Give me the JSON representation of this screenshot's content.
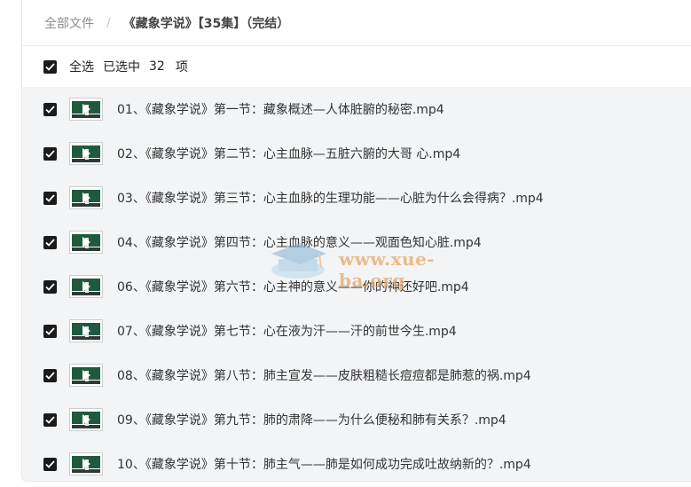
{
  "breadcrumb": {
    "root": "全部文件",
    "separator": "/",
    "current": "《藏象学说》【35集】（完结）"
  },
  "selection": {
    "select_all_label": "全选",
    "selected_label": "已选中",
    "count": "32",
    "unit": "项",
    "all_checked": true
  },
  "files": [
    {
      "name": "01、《藏象学说》第一节：藏象概述—人体脏腑的秘密.mp4",
      "checked": true
    },
    {
      "name": "02、《藏象学说》第二节：心主血脉—五脏六腑的大哥 心.mp4",
      "checked": true
    },
    {
      "name": "03、《藏象学说》第三节：心主血脉的生理功能——心脏为什么会得病？.mp4",
      "checked": true
    },
    {
      "name": "04、《藏象学说》第四节：心主血脉的意义——观面色知心脏.mp4",
      "checked": true
    },
    {
      "name": "06、《藏象学说》第六节：心主神的意义——你的神还好吧.mp4",
      "checked": true
    },
    {
      "name": "07、《藏象学说》第七节：心在液为汗——汗的前世今生.mp4",
      "checked": true
    },
    {
      "name": "08、《藏象学说》第八节：肺主宣发——皮肤粗糙长痘痘都是肺惹的祸.mp4",
      "checked": true
    },
    {
      "name": "09、《藏象学说》第九节：肺的肃降——为什么便秘和肺有关系？.mp4",
      "checked": true
    },
    {
      "name": "10、《藏象学说》第十节：肺主气——肺是如何成功完成吐故纳新的？.mp4",
      "checked": true
    }
  ],
  "watermark": {
    "text": "www.xue-ba.org"
  },
  "colors": {
    "checkbox": "#1b1b1b",
    "list_bg": "#f3f4f6",
    "watermark": "#e7a765"
  }
}
